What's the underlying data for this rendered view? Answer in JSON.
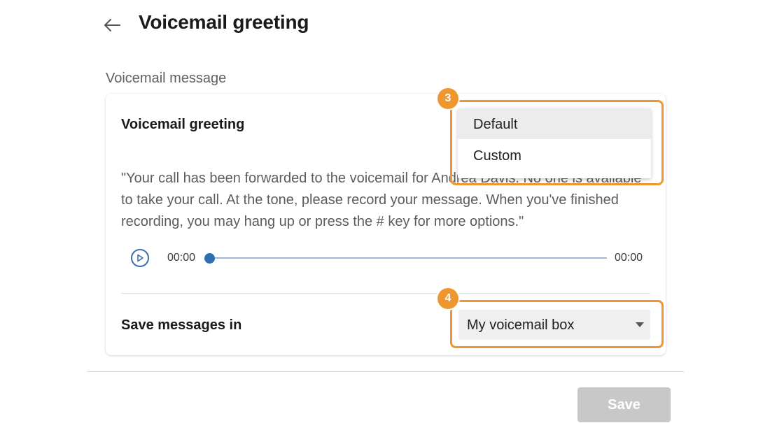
{
  "header": {
    "title": "Voicemail greeting",
    "back_icon": "arrow-left-icon"
  },
  "section": {
    "label": "Voicemail message"
  },
  "card": {
    "greeting_label": "Voicemail greeting",
    "greeting_text": "\"Your call has been forwarded to the voicemail for Andrea Davis. No one is available to take your call. At the tone, please record your message. When you've finished recording, you may hang up or press the # key for more options.\"",
    "player": {
      "play_icon": "play-circle-icon",
      "current_time": "00:00",
      "total_time": "00:00",
      "progress": 0
    },
    "save_in_label": "Save messages in",
    "save_in_select": {
      "value": "My voicemail box"
    }
  },
  "greeting_dropdown": {
    "options": [
      "Default",
      "Custom"
    ],
    "selected": "Default"
  },
  "annotations": {
    "badge_3": "3",
    "badge_4": "4",
    "color": "#f0962f"
  },
  "footer": {
    "save_label": "Save"
  }
}
